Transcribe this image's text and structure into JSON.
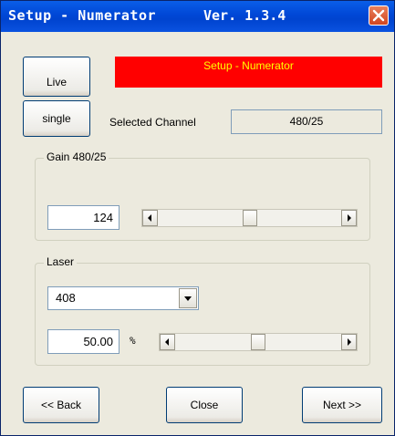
{
  "window": {
    "title": "Setup - Numerator",
    "version": "Ver. 1.3.4"
  },
  "mode_buttons": {
    "live": "Live",
    "single": "single"
  },
  "banner": {
    "text": "Setup - Numerator",
    "bg_color": "#ff0000",
    "text_color": "#ffff00"
  },
  "channel": {
    "label": "Selected Channel",
    "value": "480/25"
  },
  "gain": {
    "group_title": "Gain 480/25",
    "value": "124",
    "slider_level": 0.5
  },
  "laser": {
    "group_title": "Laser",
    "wavelength": "408",
    "power": "50.00",
    "unit": "%",
    "slider_level": 0.5
  },
  "nav": {
    "back": "<< Back",
    "close": "Close",
    "next": "Next >>"
  },
  "icons": [
    "close-icon",
    "arrow-left-icon",
    "arrow-right-icon",
    "chevron-down-icon"
  ]
}
